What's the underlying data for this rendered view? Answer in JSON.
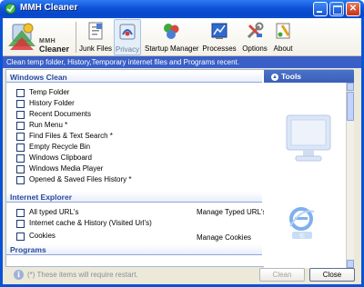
{
  "window": {
    "title": "MMH Cleaner"
  },
  "logo": {
    "line1": "MMH",
    "line2": "Cleaner"
  },
  "toolbar": {
    "items": [
      {
        "label": "Junk Files",
        "icon": "junk-files-icon"
      },
      {
        "label": "Privacy",
        "icon": "privacy-icon",
        "active": true
      },
      {
        "label": "Startup Manager",
        "icon": "startup-manager-icon"
      },
      {
        "label": "Processes",
        "icon": "processes-icon"
      },
      {
        "label": "Options",
        "icon": "options-icon"
      },
      {
        "label": "About",
        "icon": "about-icon"
      }
    ]
  },
  "subheader": "Clean temp folder, History,Temporary internet files and Programs recent.",
  "sections": {
    "windows_clean": {
      "title": "Windows Clean",
      "items": [
        "Temp Folder",
        "History Folder",
        "Recent Documents",
        "Run Menu *",
        "Find Files & Text Search *",
        "Empty Recycle Bin",
        "Windows Clipboard",
        "Windows Media Player",
        "Opened & Saved Files History *"
      ]
    },
    "internet_explorer": {
      "title": "Internet Explorer",
      "items": [
        "All typed URL's",
        "Internet cache & History (Visited Url's)",
        "Cookies"
      ],
      "links": [
        "Manage Typed URL's",
        "Manage Cookies"
      ]
    },
    "programs": {
      "title": "Programs"
    }
  },
  "tools_panel": {
    "title": "Tools"
  },
  "footer": {
    "note": "(*) These items will require restart.",
    "clean_label": "Clean",
    "close_label": "Close"
  },
  "colors": {
    "titlebar": "#0a53d8",
    "subheader": "#3a5fc6",
    "section_text": "#2c4a9a",
    "face": "#ece9d8"
  }
}
